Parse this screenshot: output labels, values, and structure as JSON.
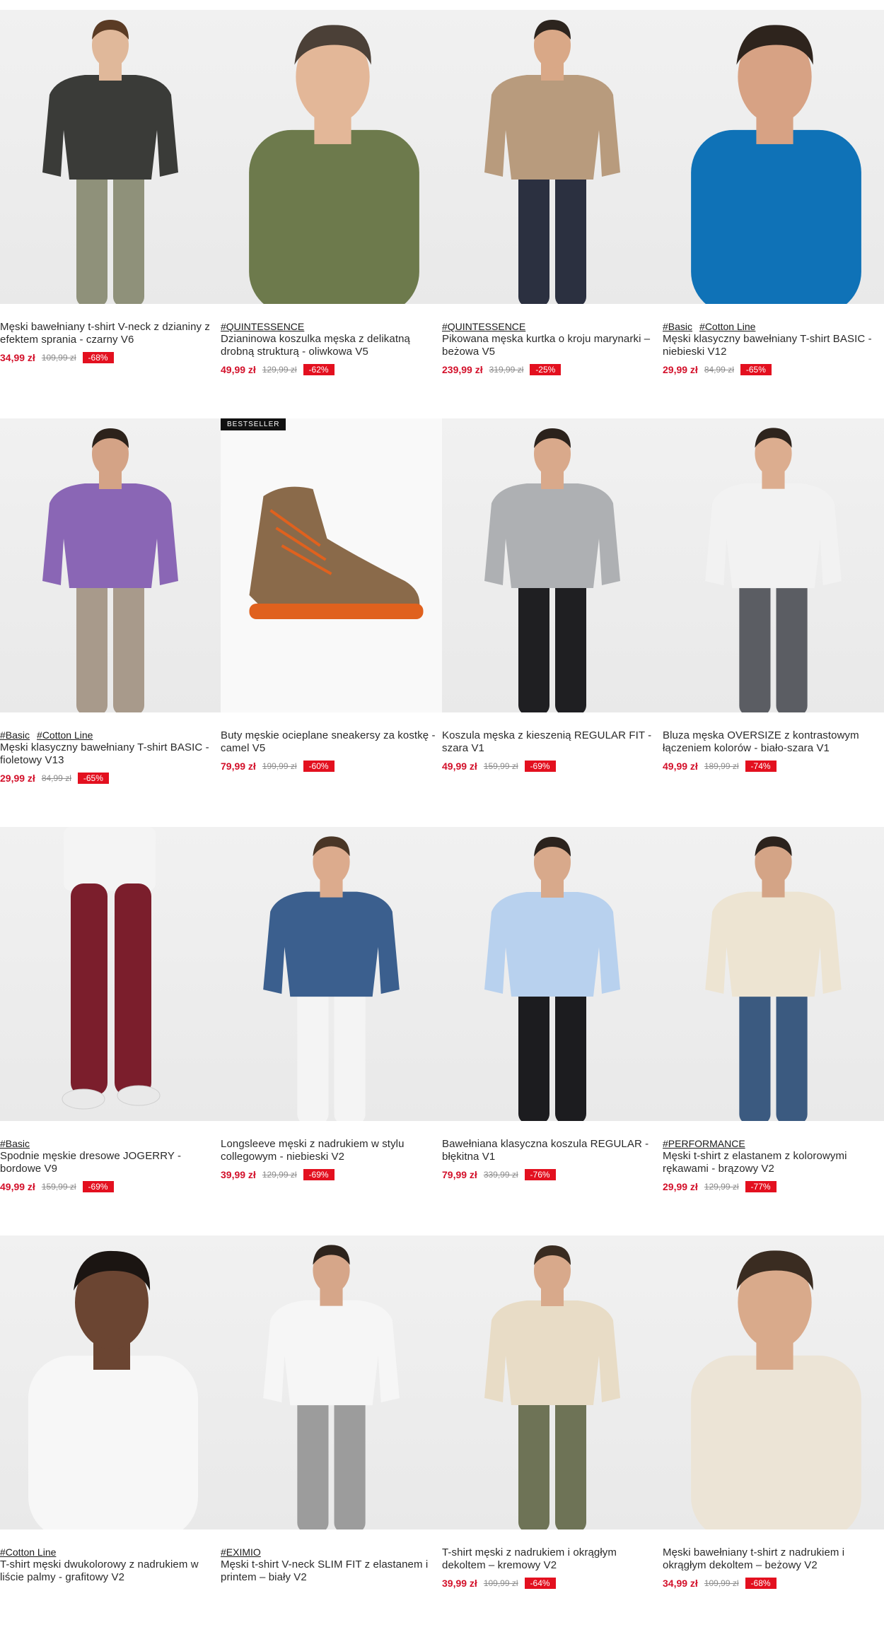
{
  "products": [
    {
      "tags": [],
      "title": "Męski bawełniany t-shirt V-neck z dzianiny z efektem sprania - czarny V6",
      "price": "34,99 zł",
      "old_price": "109,99 zł",
      "discount": "-68%",
      "colors": {
        "skin": "#e0b89a",
        "top": "#3a3b38",
        "bottom": "#8f917a",
        "hair": "#5a3b24"
      }
    },
    {
      "tags": [
        "#QUINTESSENCE"
      ],
      "title": "Dzianinowa koszulka męska z delikatną drobną strukturą - oliwkowa V5",
      "price": "49,99 zł",
      "old_price": "129,99 zł",
      "discount": "-62%",
      "colors": {
        "skin": "#e3b798",
        "top": "#6d7a4c",
        "bottom": "#6d7a4c",
        "hair": "#4b4037"
      }
    },
    {
      "tags": [
        "#QUINTESSENCE"
      ],
      "title": "Pikowana męska kurtka o kroju marynarki – beżowa V5",
      "price": "239,99 zł",
      "old_price": "319,99 zł",
      "discount": "-25%",
      "colors": {
        "skin": "#d9a887",
        "top": "#b89b7d",
        "bottom": "#2b3040",
        "hair": "#2c241e"
      }
    },
    {
      "tags": [
        "#Basic",
        "#Cotton Line"
      ],
      "title": "Męski klasyczny bawełniany T-shirt BASIC - niebieski V12",
      "price": "29,99 zł",
      "old_price": "84,99 zł",
      "discount": "-65%",
      "colors": {
        "skin": "#d7a284",
        "top": "#0f72b7",
        "bottom": "#0f72b7",
        "hair": "#2e241d"
      }
    },
    {
      "tags": [
        "#Basic",
        "#Cotton Line"
      ],
      "title": "Męski klasyczny bawełniany T-shirt BASIC - fioletowy V13",
      "price": "29,99 zł",
      "old_price": "84,99 zł",
      "discount": "-65%",
      "colors": {
        "skin": "#d4a386",
        "top": "#8a66b5",
        "bottom": "#a89a8b",
        "hair": "#2c221b"
      }
    },
    {
      "tags": [],
      "badge": "BESTSELLER",
      "title": "Buty męskie ocieplane sneakersy za kostkę - camel V5",
      "price": "79,99 zł",
      "old_price": "199,99 zł",
      "discount": "-60%",
      "colors": {
        "shoe": "#8a6a4a",
        "sole": "#e0611e"
      }
    },
    {
      "tags": [],
      "title": "Koszula męska z kieszenią REGULAR FIT - szara V1",
      "price": "49,99 zł",
      "old_price": "159,99 zł",
      "discount": "-69%",
      "colors": {
        "skin": "#d9a98b",
        "top": "#aeb0b3",
        "bottom": "#1f1f22",
        "hair": "#2b221c"
      }
    },
    {
      "tags": [],
      "title": "Bluza męska OVERSIZE z kontrastowym łączeniem kolorów - biało-szara V1",
      "price": "49,99 zł",
      "old_price": "189,99 zł",
      "discount": "-74%",
      "colors": {
        "skin": "#dcad8f",
        "top": "#f2f2f2",
        "bottom": "#5b5d63",
        "hair": "#2e241d"
      }
    },
    {
      "tags": [
        "#Basic"
      ],
      "title": "Spodnie męskie dresowe JOGERRY - bordowe V9",
      "price": "49,99 zł",
      "old_price": "159,99 zł",
      "discount": "-69%",
      "colors": {
        "skin": "#d2a285",
        "top": "#f4f4f4",
        "bottom": "#7b1e2c",
        "hair": "#2e241d"
      }
    },
    {
      "tags": [],
      "title": "Longsleeve męski z nadrukiem w stylu collegowym - niebieski V2",
      "price": "39,99 zł",
      "old_price": "129,99 zł",
      "discount": "-69%",
      "colors": {
        "skin": "#dcab8d",
        "top": "#3b5f8e",
        "bottom": "#f4f4f4",
        "hair": "#4a3626"
      }
    },
    {
      "tags": [],
      "title": "Bawełniana klasyczna koszula REGULAR - błękitna V1",
      "price": "79,99 zł",
      "old_price": "339,99 zł",
      "discount": "-76%",
      "colors": {
        "skin": "#d8a98b",
        "top": "#b8d1ee",
        "bottom": "#1c1c1f",
        "hair": "#2c231d"
      }
    },
    {
      "tags": [
        "#PERFORMANCE"
      ],
      "title": "Męski t-shirt z elastanem z kolorowymi rękawami - brązowy V2",
      "price": "29,99 zł",
      "old_price": "129,99 zł",
      "discount": "-77%",
      "colors": {
        "skin": "#d4a486",
        "top": "#ede4d2",
        "bottom": "#3b5a80",
        "hair": "#2c231d"
      }
    },
    {
      "tags": [
        "#Cotton Line"
      ],
      "title": "T-shirt męski dwukolorowy z nadrukiem w liście palmy - grafitowy V2",
      "price": "",
      "old_price": "",
      "discount": "",
      "colors": {
        "skin": "#6b4532",
        "top": "#f7f7f7",
        "bottom": "#4a4b4e",
        "hair": "#1b1512"
      }
    },
    {
      "tags": [
        "#EXIMIO"
      ],
      "title": "Męski t-shirt V-neck SLIM FIT z elastanem i printem – biały V2",
      "price": "",
      "old_price": "",
      "discount": "",
      "colors": {
        "skin": "#d6a689",
        "top": "#f6f6f6",
        "bottom": "#9c9c9c",
        "hair": "#2d231c"
      }
    },
    {
      "tags": [],
      "title": "T-shirt męski z nadrukiem i okrągłym dekoltem – kremowy V2",
      "price": "39,99 zł",
      "old_price": "109,99 zł",
      "discount": "-64%",
      "colors": {
        "skin": "#d8a98b",
        "top": "#e8dcc6",
        "bottom": "#6e7356",
        "hair": "#3a2c21"
      }
    },
    {
      "tags": [],
      "title": "Męski bawełniany t-shirt z nadrukiem i okrągłym dekoltem – beżowy V2",
      "price": "34,99 zł",
      "old_price": "109,99 zł",
      "discount": "-68%",
      "colors": {
        "skin": "#d9aa8b",
        "top": "#ece4d6",
        "bottom": "#ece4d6",
        "hair": "#3a2c21"
      }
    }
  ]
}
